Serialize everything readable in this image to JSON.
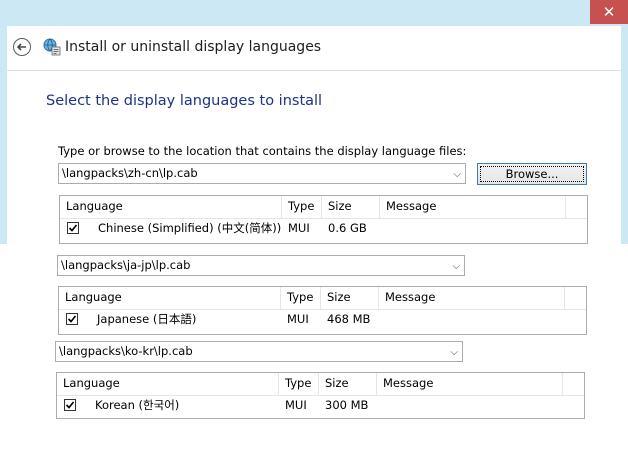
{
  "window": {
    "title": "Install or uninstall display languages",
    "close_glyph": "✕"
  },
  "page": {
    "heading": "Select the display languages to install",
    "instruction": "Type or browse to the location that contains the display language files:",
    "browse_label": "Browse..."
  },
  "table_headers": {
    "language": "Language",
    "type": "Type",
    "size": "Size",
    "message": "Message"
  },
  "packs": [
    {
      "path": "\\langpacks\\zh-cn\\lp.cab",
      "language": "Chinese (Simplified) (中文(简体))",
      "type": "MUI",
      "size": "0.6 GB",
      "message": "",
      "checked": true
    },
    {
      "path": "\\langpacks\\ja-jp\\lp.cab",
      "language": "Japanese (日本語)",
      "type": "MUI",
      "size": "468 MB",
      "message": "",
      "checked": true
    },
    {
      "path": "\\langpacks\\ko-kr\\lp.cab",
      "language": "Korean (한국어)",
      "type": "MUI",
      "size": "300 MB",
      "message": "",
      "checked": true
    }
  ],
  "icons": {
    "back": "back-arrow-icon",
    "app": "globe-language-icon",
    "close": "close-icon",
    "dropdown": "chevron-down-icon",
    "checkbox": "checkmark-icon"
  },
  "colors": {
    "titlebar": "#cce8f5",
    "close_button": "#c75050",
    "heading": "#1e3287"
  }
}
